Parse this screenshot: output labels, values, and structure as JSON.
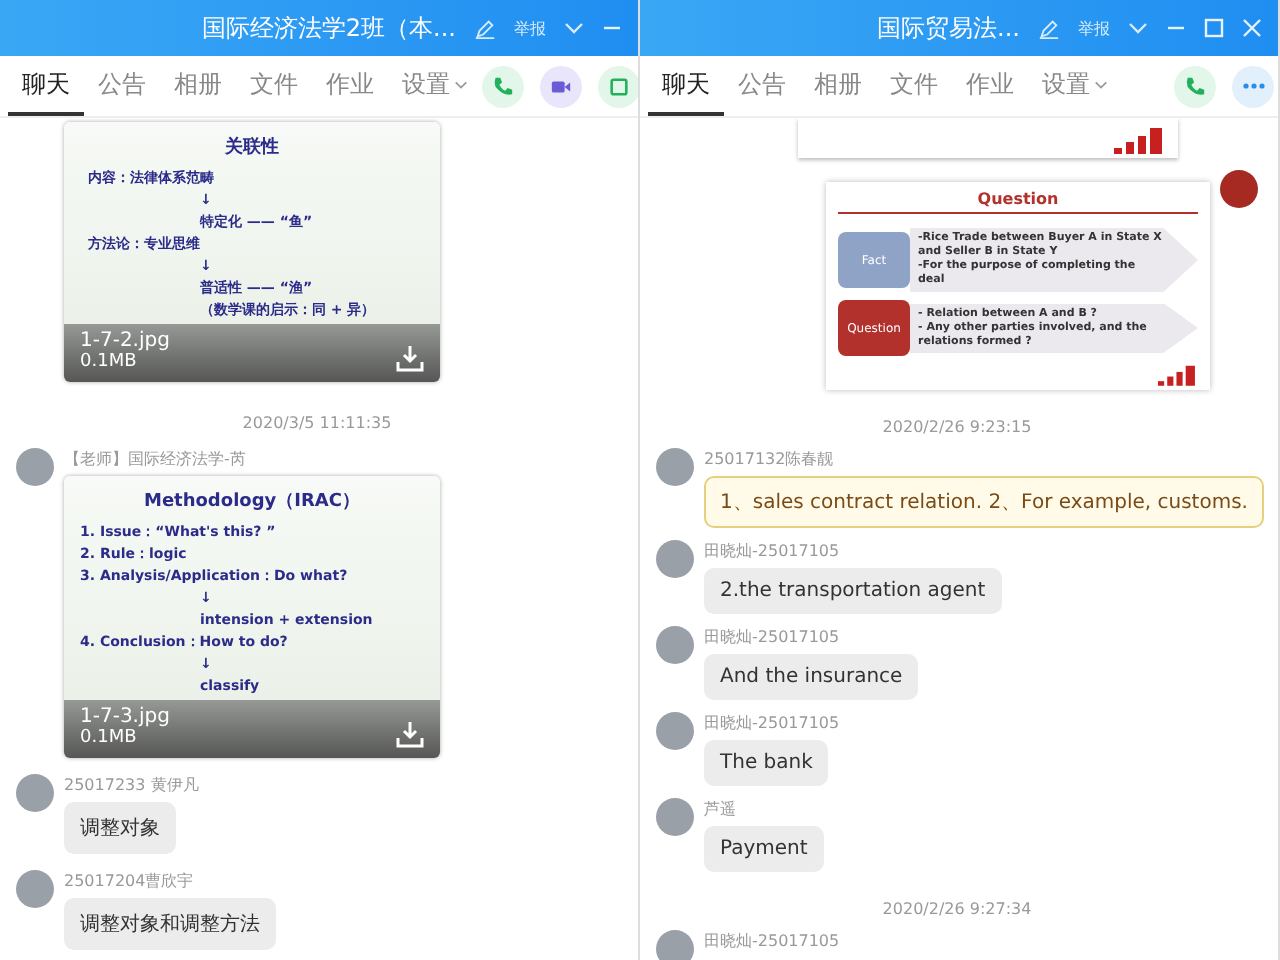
{
  "windows": [
    {
      "title": "国际经济法学2班（本...",
      "report": "举报",
      "window_buttons": [
        {
          "kind": "minimize"
        }
      ],
      "tabs": [
        {
          "label": "聊天",
          "selected": true,
          "has_menu": false
        },
        {
          "label": "公告",
          "selected": false,
          "has_menu": false
        },
        {
          "label": "相册",
          "selected": false,
          "has_menu": false
        },
        {
          "label": "文件",
          "selected": false,
          "has_menu": false
        },
        {
          "label": "作业",
          "selected": false,
          "has_menu": false
        },
        {
          "label": "设置",
          "selected": false,
          "has_menu": true
        }
      ],
      "call_buttons": [
        {
          "kind": "phone"
        },
        {
          "kind": "video"
        },
        {
          "kind": "file"
        }
      ],
      "messages": [
        {
          "kind": "image",
          "outgoing": false,
          "slide": {
            "kind": "text",
            "title": "关联性",
            "lines": [
              {
                "kind": "bullet",
                "text": "内容：法律体系范畴"
              },
              {
                "kind": "indent",
                "text": "↓"
              },
              {
                "kind": "indent",
                "text": "特定化 —— “鱼”"
              },
              {
                "kind": "bullet",
                "text": "方法论：专业思维"
              },
              {
                "kind": "indent",
                "text": "↓"
              },
              {
                "kind": "indent",
                "text": "普适性 —— “渔”"
              },
              {
                "kind": "indent",
                "text": "（数学课的启示：同 + 异）"
              }
            ]
          },
          "filename": "1-7-2.jpg",
          "size": "0.1MB"
        },
        {
          "kind": "time",
          "text": "2020/3/5 11:11:35"
        },
        {
          "kind": "image",
          "outgoing": false,
          "sender": "【老师】国际经济法学-芮",
          "slide": {
            "kind": "text",
            "title": "Methodology（IRAC）",
            "lines": [
              {
                "kind": "plain",
                "text": "1. Issue：“What's this? ”"
              },
              {
                "kind": "plain",
                "text": "2. Rule：logic"
              },
              {
                "kind": "plain",
                "text": "3. Analysis/Application：Do what?"
              },
              {
                "kind": "indent",
                "text": "↓"
              },
              {
                "kind": "indent",
                "text": "intension + extension"
              },
              {
                "kind": "plain",
                "text": "4. Conclusion：How to do?"
              },
              {
                "kind": "indent",
                "text": "↓"
              },
              {
                "kind": "indent",
                "text": "classify"
              }
            ]
          },
          "filename": "1-7-3.jpg",
          "size": "0.1MB"
        },
        {
          "kind": "text",
          "outgoing": false,
          "highlighted": false,
          "sender": "25017233 黄伊凡",
          "text": "调整对象"
        },
        {
          "kind": "text",
          "outgoing": false,
          "highlighted": false,
          "sender": "25017204曹欣宇",
          "text": "调整对象和调整方法"
        }
      ]
    },
    {
      "title": "国际贸易法...",
      "report": "举报",
      "window_buttons": [
        {
          "kind": "minimize"
        },
        {
          "kind": "maximize"
        },
        {
          "kind": "close"
        }
      ],
      "tabs": [
        {
          "label": "聊天",
          "selected": true,
          "has_menu": false
        },
        {
          "label": "公告",
          "selected": false,
          "has_menu": false
        },
        {
          "label": "相册",
          "selected": false,
          "has_menu": false
        },
        {
          "label": "文件",
          "selected": false,
          "has_menu": false
        },
        {
          "label": "作业",
          "selected": false,
          "has_menu": false
        },
        {
          "label": "设置",
          "selected": false,
          "has_menu": true
        }
      ],
      "call_buttons": [
        {
          "kind": "phone"
        },
        {
          "kind": "more"
        }
      ],
      "messages": [
        {
          "kind": "image",
          "outgoing": true,
          "slide": {
            "kind": "edge"
          }
        },
        {
          "kind": "image",
          "outgoing": true,
          "slide": {
            "kind": "diagram",
            "title": "Question",
            "rows": [
              {
                "label": "Fact",
                "color": "#8fa3c6",
                "lines": [
                  "-Rice Trade between Buyer A in State X and Seller B in State Y",
                  "-For the purpose of completing the deal"
                ]
              },
              {
                "label": "Question",
                "color": "#b3312c",
                "lines": [
                  "- Relation between A and B ?",
                  "- Any other parties involved, and the relations formed ?"
                ]
              }
            ]
          }
        },
        {
          "kind": "time",
          "text": "2020/2/26 9:23:15"
        },
        {
          "kind": "text",
          "outgoing": false,
          "highlighted": true,
          "sender": "25017132陈春靓",
          "text": "1、sales contract relation. 2、For example, customs."
        },
        {
          "kind": "text",
          "outgoing": false,
          "highlighted": false,
          "sender": "田晓灿-25017105",
          "text": "2.the transportation agent"
        },
        {
          "kind": "text",
          "outgoing": false,
          "highlighted": false,
          "sender": "田晓灿-25017105",
          "text": "And the insurance"
        },
        {
          "kind": "text",
          "outgoing": false,
          "highlighted": false,
          "sender": "田晓灿-25017105",
          "text": "The bank"
        },
        {
          "kind": "text",
          "outgoing": false,
          "highlighted": false,
          "sender": "芦遥",
          "text": "Payment"
        },
        {
          "kind": "time",
          "text": "2020/2/26 9:27:34"
        },
        {
          "kind": "text",
          "outgoing": false,
          "sender": "田晓灿-25017105"
        }
      ]
    }
  ]
}
